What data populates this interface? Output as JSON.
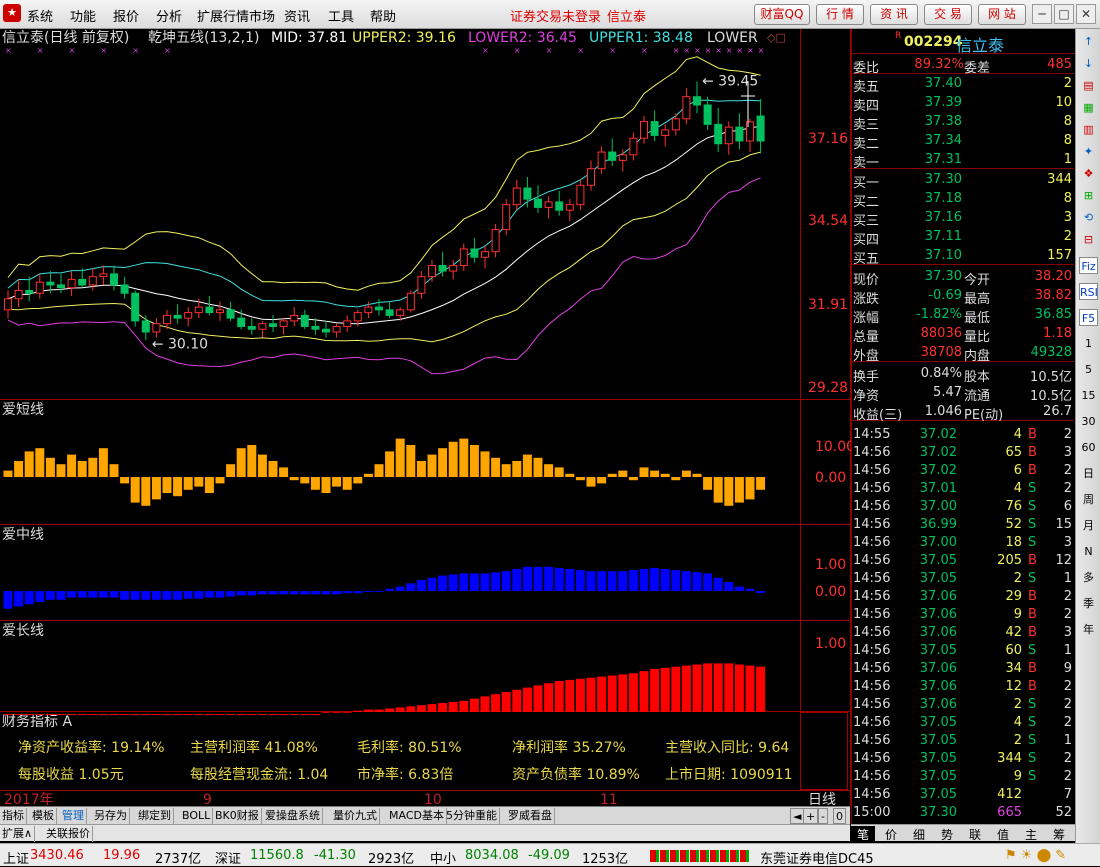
{
  "menubar": {
    "items": [
      "系统",
      "功能",
      "报价",
      "分析",
      "扩展行情市场",
      "资讯",
      "工具",
      "帮助"
    ],
    "status": "证券交易未登录",
    "stock": "信立泰",
    "buttons": [
      "财富QQ",
      "行 情",
      "资 讯",
      "交 易",
      "网 站"
    ]
  },
  "main_chart": {
    "title": "信立泰(日线 前复权)",
    "indicator": "乾坤五线(13,2,1)",
    "mid_label": "MID: 37.81",
    "upper2_label": "UPPER2: 39.16",
    "lower2_label": "LOWER2: 36.45",
    "upper1_label": "UPPER1: 38.48",
    "lower1_label": "LOWER",
    "price_ticks": [
      "37.16",
      "34.54",
      "31.91",
      "29.28"
    ],
    "high_label": "39.45",
    "low_label": "30.10"
  },
  "pane_titles": {
    "short": "爱短线",
    "mid": "爱中线",
    "long": "爱长线",
    "fin": "财务指标 A"
  },
  "pane_ticks": {
    "short": [
      "10.00",
      "0.00"
    ],
    "mid": [
      "1.00",
      "0.00"
    ],
    "long": [
      "1.00"
    ]
  },
  "finance": {
    "row1": [
      "净资产收益率: 19.14%",
      "主营利润率 41.08%",
      "毛利率: 80.51%",
      "净利润率 35.27%",
      "主营收入同比: 9.64"
    ],
    "row2": [
      "每股收益 1.05元",
      "每股经营现金流: 1.04",
      "市净率: 6.83倍",
      "资产负债率 10.89%",
      "上市日期: 1090911"
    ]
  },
  "time_axis": {
    "labels": [
      "2017年",
      "9",
      "10",
      "11"
    ],
    "period": "日线"
  },
  "bottom_tabs": [
    "指标",
    "模板",
    "管理",
    "另存为",
    "绑定到",
    "BOLL",
    "BK0财报",
    "爱操盘系统",
    "量价九式",
    "MACD基本",
    "5分钟重能",
    "罗威看盘"
  ],
  "bottom_tabs2": [
    "扩展∧",
    "关联报价"
  ],
  "quote": {
    "code": "002294",
    "name": "信立泰",
    "weibi_label": "委比",
    "weibi": "89.32%",
    "weicha_label": "委差",
    "weicha": "485",
    "asks": [
      [
        "卖五",
        "37.40",
        "2"
      ],
      [
        "卖四",
        "37.39",
        "10"
      ],
      [
        "卖三",
        "37.38",
        "8"
      ],
      [
        "卖二",
        "37.34",
        "8"
      ],
      [
        "卖一",
        "37.31",
        "1"
      ]
    ],
    "bids": [
      [
        "买一",
        "37.30",
        "344"
      ],
      [
        "买二",
        "37.18",
        "8"
      ],
      [
        "买三",
        "37.16",
        "3"
      ],
      [
        "买四",
        "37.11",
        "2"
      ],
      [
        "买五",
        "37.10",
        "157"
      ]
    ],
    "stats": [
      [
        "现价",
        "37.30",
        "今开",
        "38.20"
      ],
      [
        "涨跌",
        "-0.69",
        "最高",
        "38.82"
      ],
      [
        "涨幅",
        "-1.82%",
        "最低",
        "36.85"
      ],
      [
        "总量",
        "88036",
        "量比",
        "1.18"
      ],
      [
        "外盘",
        "38708",
        "内盘",
        "49328"
      ]
    ],
    "stats2": [
      [
        "换手",
        "0.84%",
        "股本",
        "10.5亿"
      ],
      [
        "净资",
        "5.47",
        "流通",
        "10.5亿"
      ],
      [
        "收益(三)",
        "1.046",
        "PE(动)",
        "26.7"
      ]
    ],
    "ticks": [
      [
        "14:55",
        "37.02",
        "4",
        "B",
        "2"
      ],
      [
        "14:56",
        "37.02",
        "65",
        "B",
        "3"
      ],
      [
        "14:56",
        "37.02",
        "6",
        "B",
        "2"
      ],
      [
        "14:56",
        "37.01",
        "4",
        "S",
        "2"
      ],
      [
        "14:56",
        "37.00",
        "76",
        "S",
        "6"
      ],
      [
        "14:56",
        "36.99",
        "52",
        "S",
        "15"
      ],
      [
        "14:56",
        "37.00",
        "18",
        "S",
        "3"
      ],
      [
        "14:56",
        "37.05",
        "205",
        "B",
        "12"
      ],
      [
        "14:56",
        "37.05",
        "2",
        "S",
        "1"
      ],
      [
        "14:56",
        "37.06",
        "29",
        "B",
        "2"
      ],
      [
        "14:56",
        "37.06",
        "9",
        "B",
        "2"
      ],
      [
        "14:56",
        "37.06",
        "42",
        "B",
        "3"
      ],
      [
        "14:56",
        "37.05",
        "60",
        "S",
        "1"
      ],
      [
        "14:56",
        "37.06",
        "34",
        "B",
        "9"
      ],
      [
        "14:56",
        "37.06",
        "12",
        "B",
        "2"
      ],
      [
        "14:56",
        "37.06",
        "2",
        "S",
        "2"
      ],
      [
        "14:56",
        "37.05",
        "4",
        "S",
        "2"
      ],
      [
        "14:56",
        "37.05",
        "2",
        "S",
        "1"
      ],
      [
        "14:56",
        "37.05",
        "344",
        "S",
        "2"
      ],
      [
        "14:56",
        "37.05",
        "9",
        "S",
        "2"
      ],
      [
        "14:56",
        "37.05",
        "412",
        "",
        "7"
      ],
      [
        "15:00",
        "37.30",
        "665",
        "",
        "52"
      ]
    ],
    "tabs": [
      "笔",
      "价",
      "细",
      "势",
      "联",
      "值",
      "主",
      "筹"
    ]
  },
  "sidebar": [
    "Fiz",
    "RSI",
    "F5",
    "1",
    "5",
    "15",
    "30",
    "60",
    "日",
    "周",
    "月",
    "N",
    "多",
    "季",
    "年"
  ],
  "ticker": {
    "sh_label": "上证",
    "sh_val": "3430.46",
    "sh_chg": "19.96",
    "sh_amt": "2737亿",
    "sz_label": "深证",
    "sz_val": "11560.8",
    "sz_chg": "-41.30",
    "sz_amt": "2923亿",
    "zx_label": "中小",
    "zx_val": "8034.08",
    "zx_chg": "-49.09",
    "zx_amt": "1253亿",
    "broker": "东莞证券电信DC45"
  },
  "colors": {
    "up": "#ff3030",
    "down": "#00c060",
    "mid": "#ffffff",
    "upper1": "#40e0e0",
    "upper2": "#f0f060",
    "lower1": "#f0f060",
    "lower2": "#e040e0",
    "short": "#ffa500",
    "midbar": "#0000ff",
    "long": "#ff0000"
  },
  "chart_data": {
    "type": "candlestick",
    "price_range": [
      29.28,
      39.9
    ],
    "candles": [
      [
        31.2,
        31.9,
        30.9,
        31.6
      ],
      [
        31.6,
        32.3,
        31.3,
        31.9
      ],
      [
        31.9,
        32.4,
        31.5,
        31.8
      ],
      [
        31.8,
        32.5,
        31.6,
        32.2
      ],
      [
        32.2,
        32.6,
        31.8,
        32.1
      ],
      [
        32.1,
        32.5,
        31.8,
        32.0
      ],
      [
        32.0,
        32.6,
        31.7,
        32.3
      ],
      [
        32.3,
        32.7,
        32.0,
        32.1
      ],
      [
        32.1,
        32.7,
        31.9,
        32.4
      ],
      [
        32.4,
        32.8,
        32.1,
        32.5
      ],
      [
        32.5,
        32.8,
        31.9,
        32.1
      ],
      [
        32.1,
        32.4,
        31.6,
        31.8
      ],
      [
        31.8,
        31.9,
        30.6,
        30.8
      ],
      [
        30.8,
        31.0,
        30.1,
        30.4
      ],
      [
        30.4,
        30.9,
        30.2,
        30.7
      ],
      [
        30.7,
        31.2,
        30.5,
        31.0
      ],
      [
        31.0,
        31.4,
        30.7,
        30.9
      ],
      [
        30.9,
        31.3,
        30.6,
        31.1
      ],
      [
        31.1,
        31.6,
        30.9,
        31.3
      ],
      [
        31.3,
        31.7,
        31.0,
        31.1
      ],
      [
        31.1,
        31.5,
        30.8,
        31.2
      ],
      [
        31.2,
        31.5,
        30.8,
        30.9
      ],
      [
        30.9,
        31.2,
        30.5,
        30.6
      ],
      [
        30.6,
        30.9,
        30.3,
        30.5
      ],
      [
        30.5,
        30.8,
        30.2,
        30.7
      ],
      [
        30.7,
        31.0,
        30.4,
        30.6
      ],
      [
        30.6,
        30.9,
        30.3,
        30.8
      ],
      [
        30.8,
        31.3,
        30.6,
        31.0
      ],
      [
        31.0,
        31.2,
        30.5,
        30.6
      ],
      [
        30.6,
        30.9,
        30.3,
        30.5
      ],
      [
        30.5,
        30.8,
        30.2,
        30.4
      ],
      [
        30.4,
        30.7,
        30.2,
        30.6
      ],
      [
        30.6,
        31.0,
        30.4,
        30.8
      ],
      [
        30.8,
        31.2,
        30.6,
        31.1
      ],
      [
        31.1,
        31.5,
        30.9,
        31.3
      ],
      [
        31.3,
        31.6,
        31.0,
        31.2
      ],
      [
        31.2,
        31.5,
        30.9,
        31.0
      ],
      [
        31.0,
        31.3,
        30.8,
        31.2
      ],
      [
        31.2,
        31.9,
        31.1,
        31.8
      ],
      [
        31.8,
        32.6,
        31.6,
        32.4
      ],
      [
        32.4,
        33.0,
        32.2,
        32.8
      ],
      [
        32.8,
        33.3,
        32.4,
        32.6
      ],
      [
        32.6,
        33.0,
        32.3,
        32.8
      ],
      [
        32.8,
        33.6,
        32.6,
        33.4
      ],
      [
        33.4,
        33.8,
        32.9,
        33.1
      ],
      [
        33.1,
        33.5,
        32.7,
        33.3
      ],
      [
        33.3,
        34.3,
        33.1,
        34.1
      ],
      [
        34.1,
        35.2,
        33.9,
        35.0
      ],
      [
        35.0,
        35.9,
        34.8,
        35.6
      ],
      [
        35.6,
        36.0,
        34.9,
        35.2
      ],
      [
        35.2,
        35.7,
        34.7,
        34.9
      ],
      [
        34.9,
        35.3,
        34.5,
        35.1
      ],
      [
        35.1,
        35.5,
        34.6,
        34.8
      ],
      [
        34.8,
        35.2,
        34.4,
        35.0
      ],
      [
        35.0,
        35.9,
        34.8,
        35.7
      ],
      [
        35.7,
        36.6,
        35.5,
        36.3
      ],
      [
        36.3,
        37.1,
        36.1,
        36.9
      ],
      [
        36.9,
        37.4,
        36.4,
        36.6
      ],
      [
        36.6,
        37.0,
        36.2,
        36.8
      ],
      [
        36.8,
        37.6,
        36.6,
        37.4
      ],
      [
        37.4,
        38.2,
        37.2,
        38.0
      ],
      [
        38.0,
        38.4,
        37.3,
        37.5
      ],
      [
        37.5,
        37.9,
        37.1,
        37.7
      ],
      [
        37.7,
        38.3,
        37.5,
        38.1
      ],
      [
        38.1,
        39.2,
        37.9,
        38.9
      ],
      [
        38.9,
        39.45,
        38.3,
        38.6
      ],
      [
        38.6,
        38.9,
        37.7,
        37.9
      ],
      [
        37.9,
        38.5,
        36.9,
        37.2
      ],
      [
        37.2,
        38.0,
        36.8,
        37.8
      ],
      [
        37.8,
        38.3,
        37.0,
        37.3
      ],
      [
        37.3,
        38.1,
        36.9,
        37.99
      ],
      [
        38.2,
        38.82,
        36.85,
        37.3
      ]
    ],
    "short_line": [
      2,
      5,
      8,
      9,
      6,
      4,
      7,
      5,
      6,
      9,
      4,
      -2,
      -8,
      -9,
      -7,
      -5,
      -6,
      -4,
      -3,
      -5,
      -2,
      4,
      9,
      10,
      7,
      5,
      3,
      -1,
      -2,
      -4,
      -5,
      -3,
      -4,
      -2,
      1,
      4,
      8,
      12,
      10,
      5,
      7,
      9,
      11,
      12,
      10,
      8,
      6,
      4,
      5,
      7,
      6,
      4,
      3,
      1,
      -1,
      -3,
      -2,
      1,
      2,
      -1,
      3,
      2,
      1,
      -1,
      2,
      1,
      -4,
      -8,
      -9,
      -8,
      -7,
      -4
    ],
    "mid_line": [
      -0.8,
      -0.7,
      -0.6,
      -0.5,
      -0.4,
      -0.4,
      -0.3,
      -0.3,
      -0.3,
      -0.3,
      -0.3,
      -0.4,
      -0.4,
      -0.4,
      -0.4,
      -0.4,
      -0.4,
      -0.35,
      -0.35,
      -0.3,
      -0.3,
      -0.25,
      -0.2,
      -0.2,
      -0.15,
      -0.15,
      -0.15,
      -0.15,
      -0.15,
      -0.15,
      -0.15,
      -0.15,
      -0.1,
      -0.1,
      -0.05,
      0,
      0.1,
      0.2,
      0.35,
      0.5,
      0.6,
      0.7,
      0.75,
      0.8,
      0.8,
      0.8,
      0.85,
      0.9,
      1.0,
      1.1,
      1.1,
      1.1,
      1.05,
      1.0,
      0.95,
      0.9,
      0.9,
      0.9,
      0.9,
      0.95,
      1.0,
      1.05,
      1.0,
      0.95,
      0.9,
      0.85,
      0.8,
      0.6,
      0.4,
      0.2,
      0.1,
      -0.1
    ],
    "long_line": [
      -1.5,
      -1.5,
      -1.5,
      -1.5,
      -1.5,
      -1.5,
      -1.5,
      -1.5,
      -1.5,
      -1.5,
      -1.5,
      -1.5,
      -1.5,
      -1.5,
      -1.5,
      -1.5,
      -1.5,
      -1.5,
      -1.5,
      -1.5,
      -1.5,
      -1.5,
      -1.5,
      -1.5,
      -1.5,
      -1.5,
      -1.5,
      -1.5,
      -1.5,
      -1.5,
      -1.4,
      -1.4,
      -1.4,
      -1.35,
      -1.3,
      -1.3,
      -1.25,
      -1.2,
      -1.15,
      -1.1,
      -1.05,
      -1.0,
      -0.95,
      -0.9,
      -0.8,
      -0.7,
      -0.6,
      -0.5,
      -0.4,
      -0.3,
      -0.2,
      -0.1,
      0,
      0.05,
      0.1,
      0.15,
      0.2,
      0.25,
      0.3,
      0.35,
      0.45,
      0.55,
      0.6,
      0.65,
      0.7,
      0.75,
      0.8,
      0.8,
      0.8,
      0.75,
      0.7,
      0.65
    ]
  }
}
